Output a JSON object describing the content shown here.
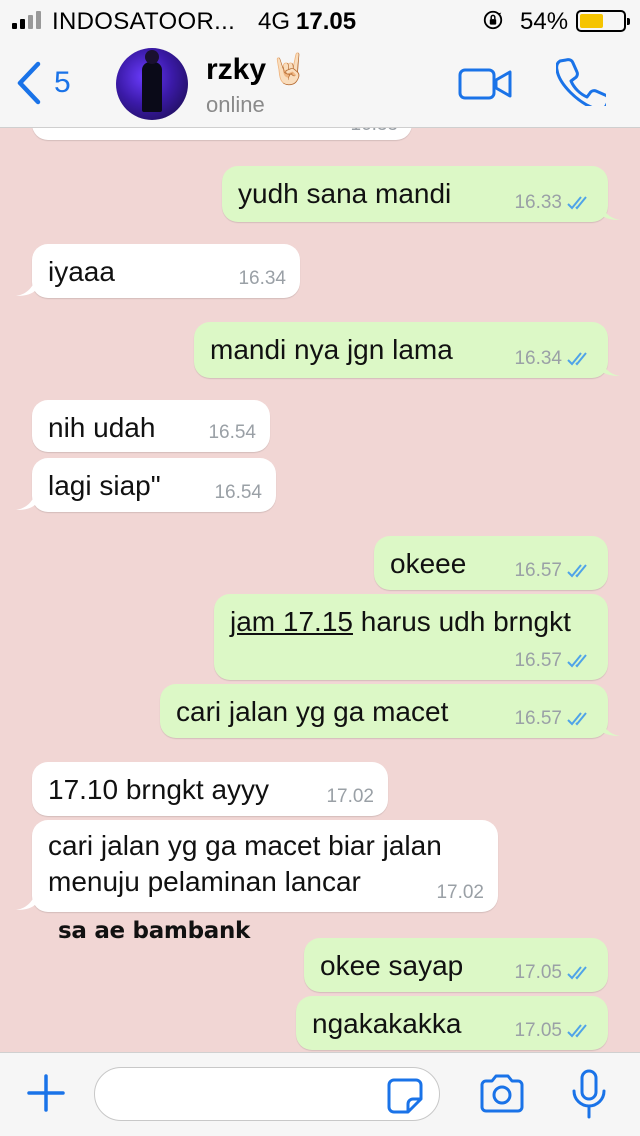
{
  "status_bar": {
    "carrier": "INDOSATOOR...",
    "network": "4G",
    "time": "17.05",
    "battery_percent": "54%",
    "battery_level": 0.54,
    "battery_color": "#f5c400"
  },
  "header": {
    "back_count": "5",
    "contact_name": "rzky",
    "contact_emoji": "🤘🏻",
    "contact_status": "online",
    "accent_color": "#1a73e8"
  },
  "chat": {
    "background_color": "#f1d6d4",
    "incoming_color": "#ffffff",
    "outgoing_color": "#dcf8c6",
    "partial_top_time": "16.33",
    "messages": [
      {
        "direction": "out",
        "text": "yudh sana mandi",
        "time": "16.33",
        "read": true
      },
      {
        "direction": "in",
        "text": "iyaaa",
        "time": "16.34"
      },
      {
        "direction": "out",
        "text": "mandi nya jgn lama",
        "time": "16.34",
        "read": true
      },
      {
        "direction": "in",
        "text": "nih udah",
        "time": "16.54"
      },
      {
        "direction": "in",
        "text": "lagi siap\"",
        "time": "16.54"
      },
      {
        "direction": "out",
        "text": "okeee",
        "time": "16.57",
        "read": true
      },
      {
        "direction": "out",
        "text_link": "jam 17.15",
        "text_rest": " harus udh brngkt",
        "time": "16.57",
        "read": true
      },
      {
        "direction": "out",
        "text": "cari jalan yg ga macet",
        "time": "16.57",
        "read": true
      },
      {
        "direction": "in",
        "text": "17.10 brngkt ayyy",
        "time": "17.02"
      },
      {
        "direction": "in",
        "line1": "cari jalan yg ga macet biar jalan",
        "line2": "menuju pelaminan lancar",
        "time": "17.02"
      },
      {
        "direction": "out",
        "text": "okee sayap",
        "time": "17.05",
        "read": true
      },
      {
        "direction": "out",
        "text": "ngakakakka",
        "time": "17.05",
        "read": true
      }
    ],
    "caption": "sa ae bambank"
  },
  "input_bar": {
    "placeholder": "",
    "value": ""
  },
  "icons": {
    "back": "chevron-left-icon",
    "video": "video-call-icon",
    "phone": "phone-call-icon",
    "plus": "plus-icon",
    "sticker": "sticker-icon",
    "camera": "camera-icon",
    "mic": "microphone-icon",
    "read_receipt": "double-check-icon"
  }
}
